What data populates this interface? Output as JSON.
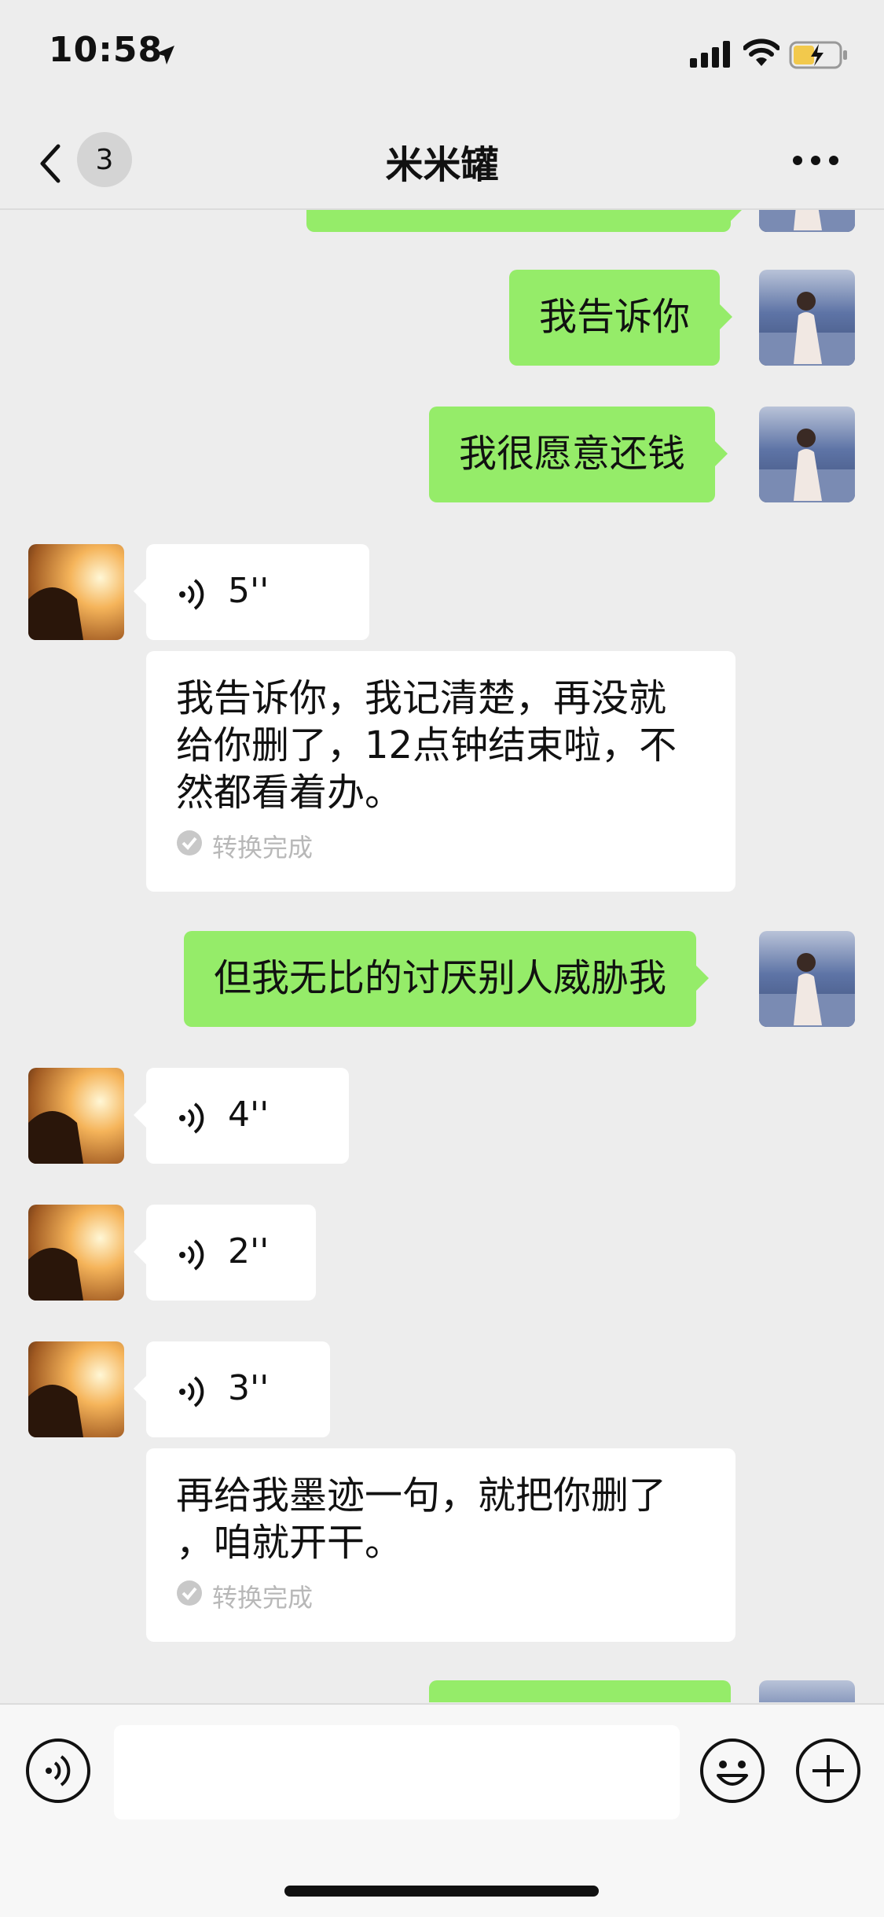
{
  "status_bar": {
    "time": "10:58",
    "icons": [
      "location-arrow-icon",
      "signal-icon",
      "wifi-icon",
      "battery-charging-icon"
    ]
  },
  "nav": {
    "unread_count": "3",
    "title": "米米罐",
    "icons": [
      "chevron-left-icon",
      "more-icon"
    ]
  },
  "messages": [
    {
      "id": "m1",
      "side": "right",
      "type": "text",
      "text": "我告诉你"
    },
    {
      "id": "m2",
      "side": "right",
      "type": "text",
      "text": "我很愿意还钱"
    },
    {
      "id": "m3",
      "side": "left",
      "type": "voice",
      "duration": "5''",
      "transcript_lines": [
        "我告诉你，我记清楚，再没就",
        "给你删了，12点钟结束啦，不",
        "然都看着办。"
      ],
      "status": "转换完成"
    },
    {
      "id": "m4",
      "side": "right",
      "type": "text",
      "text": "但我无比的讨厌别人威胁我"
    },
    {
      "id": "m5",
      "side": "left",
      "type": "voice",
      "duration": "4''"
    },
    {
      "id": "m6",
      "side": "left",
      "type": "voice",
      "duration": "2''"
    },
    {
      "id": "m7",
      "side": "left",
      "type": "voice",
      "duration": "3''",
      "transcript_lines": [
        "再给我墨迹一句，就把你删了",
        "，咱就开干。"
      ],
      "status": "转换完成"
    }
  ],
  "input_bar": {
    "placeholder": "",
    "icons": [
      "voice-mode-icon",
      "emoji-icon",
      "plus-icon"
    ]
  },
  "colors": {
    "background": "#EDEDED",
    "my_bubble": "#95EC69",
    "their_bubble": "#FFFFFF",
    "status_gray": "#B8B8B8"
  }
}
